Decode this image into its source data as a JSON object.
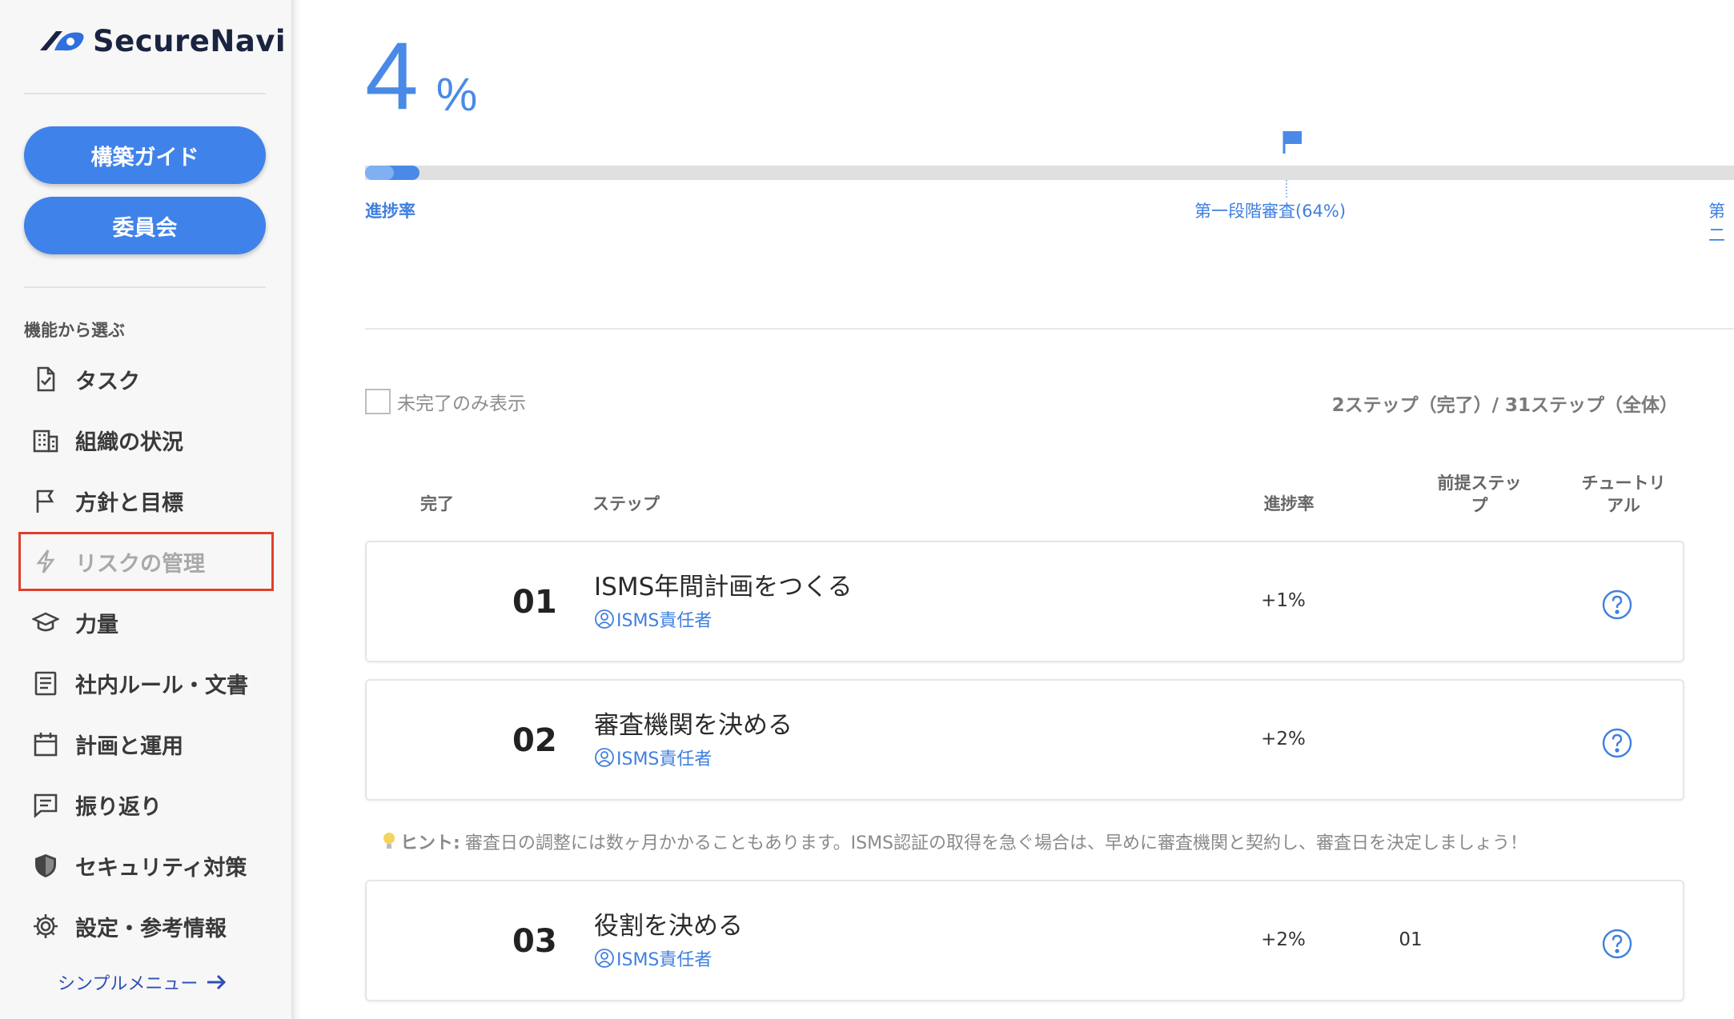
{
  "brand": {
    "name": "SecureNavi"
  },
  "sidebar": {
    "guide_button": "構築ガイド",
    "committee_button": "委員会",
    "section_label": "機能から選ぶ",
    "items": [
      {
        "label": "タスク",
        "icon": "task-check-icon"
      },
      {
        "label": "組織の状況",
        "icon": "building-icon"
      },
      {
        "label": "方針と目標",
        "icon": "flag-icon"
      },
      {
        "label": "リスクの管理",
        "icon": "lightning-icon"
      },
      {
        "label": "力量",
        "icon": "graduation-cap-icon"
      },
      {
        "label": "社内ルール・文書",
        "icon": "document-icon"
      },
      {
        "label": "計画と運用",
        "icon": "calendar-icon"
      },
      {
        "label": "振り返り",
        "icon": "message-list-icon"
      },
      {
        "label": "セキュリティ対策",
        "icon": "shield-icon"
      },
      {
        "label": "設定・参考情報",
        "icon": "gear-icon"
      }
    ],
    "simple_menu": "シンプルメニュー"
  },
  "progress": {
    "value": "4",
    "unit": "%",
    "fraction": 0.04,
    "label": "進捗率",
    "milestone_1": "第一段階審査(64%)",
    "milestone_2": "第二"
  },
  "filter": {
    "label": "未完了のみ表示",
    "checked": false
  },
  "summary": "2ステップ（完了）/ 31ステップ（全体）",
  "table": {
    "headers": {
      "done": "完了",
      "step": "ステップ",
      "progress": "進捗率",
      "prereq_1": "前提ステッ",
      "prereq_2": "プ",
      "tutorial_1": "チュートリ",
      "tutorial_2": "アル"
    },
    "rows": [
      {
        "num": "01",
        "title": "ISMS年間計画をつくる",
        "role": "ISMS責任者",
        "progress": "+1%",
        "prereq": ""
      },
      {
        "num": "02",
        "title": "審査機関を決める",
        "role": "ISMS責任者",
        "progress": "+2%",
        "prereq": ""
      },
      {
        "num": "03",
        "title": "役割を決める",
        "role": "ISMS責任者",
        "progress": "+2%",
        "prereq": "01"
      }
    ],
    "hint_label": "ヒント:",
    "hint_text": "審査日の調整には数ヶ月かかることもあります。ISMS認証の取得を急ぐ場合は、早めに審査機関と契約し、審査日を決定しましょう！"
  },
  "colors": {
    "accent": "#3f82ea",
    "link": "#3f7fe0",
    "highlight": "#e0402c"
  }
}
